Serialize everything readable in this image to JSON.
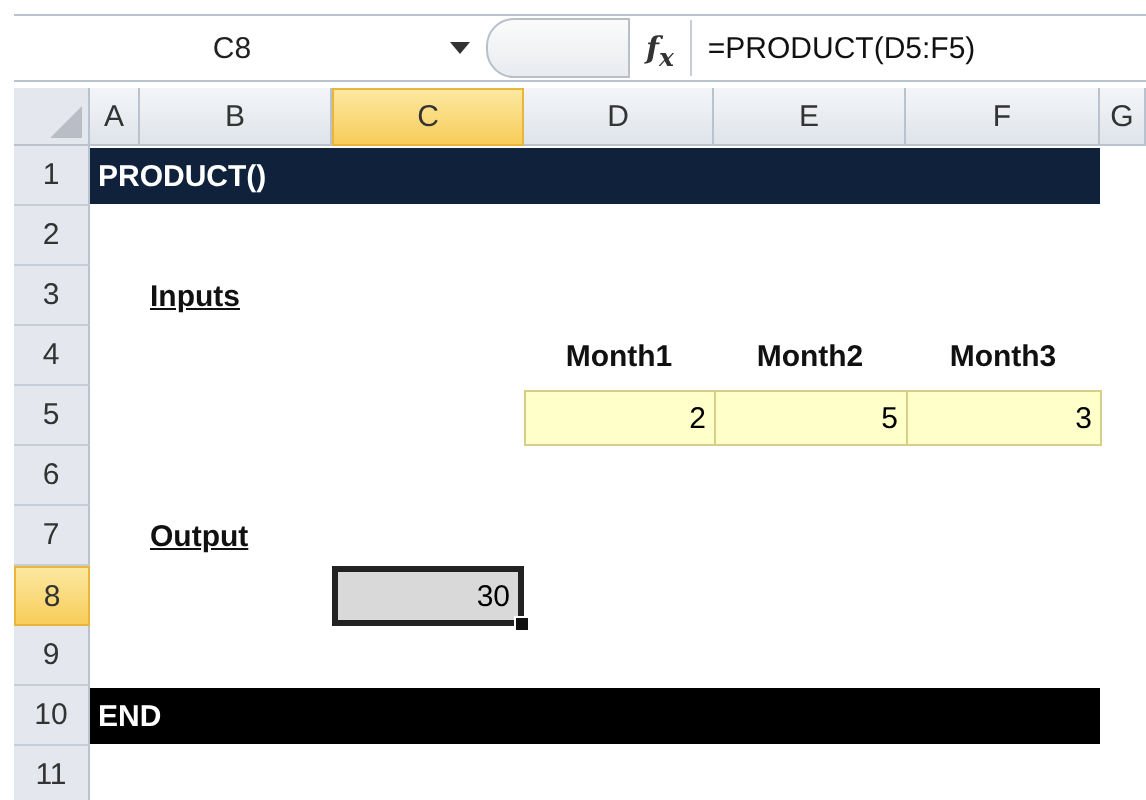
{
  "formula_bar": {
    "name_box": "C8",
    "function_label": "f$_{x}$",
    "formula": "=PRODUCT(D5:F5)"
  },
  "columns": [
    {
      "label": "A",
      "selected": false
    },
    {
      "label": "B",
      "selected": false
    },
    {
      "label": "C",
      "selected": true
    },
    {
      "label": "D",
      "selected": false
    },
    {
      "label": "E",
      "selected": false
    },
    {
      "label": "F",
      "selected": false
    },
    {
      "label": "G",
      "selected": false
    }
  ],
  "rows": [
    {
      "number": "1",
      "selected": false,
      "cells": [
        {
          "kind": "band",
          "color": "#10213b",
          "text": "PRODUCT()"
        }
      ]
    },
    {
      "number": "2",
      "selected": false,
      "cells": []
    },
    {
      "number": "3",
      "selected": false,
      "cells": [
        null,
        {
          "kind": "label",
          "text": "Inputs"
        }
      ]
    },
    {
      "number": "4",
      "selected": false,
      "cells": [
        null,
        null,
        null,
        {
          "kind": "header",
          "text": "Month1"
        },
        {
          "kind": "header",
          "text": "Month2"
        },
        {
          "kind": "header",
          "text": "Month3"
        }
      ]
    },
    {
      "number": "5",
      "selected": false,
      "cells": [
        null,
        null,
        null,
        {
          "kind": "input",
          "text": "2"
        },
        {
          "kind": "input",
          "text": "5"
        },
        {
          "kind": "input",
          "text": "3"
        }
      ]
    },
    {
      "number": "6",
      "selected": false,
      "cells": []
    },
    {
      "number": "7",
      "selected": false,
      "cells": [
        null,
        {
          "kind": "label",
          "text": "Output"
        }
      ]
    },
    {
      "number": "8",
      "selected": true,
      "cells": [
        null,
        null,
        {
          "kind": "output",
          "selected": true,
          "text": "30"
        }
      ]
    },
    {
      "number": "9",
      "selected": false,
      "cells": []
    },
    {
      "number": "10",
      "selected": false,
      "cells": [
        {
          "kind": "band",
          "color": "#000000",
          "text": "END"
        }
      ]
    },
    {
      "number": "11",
      "selected": false,
      "cells": []
    }
  ]
}
